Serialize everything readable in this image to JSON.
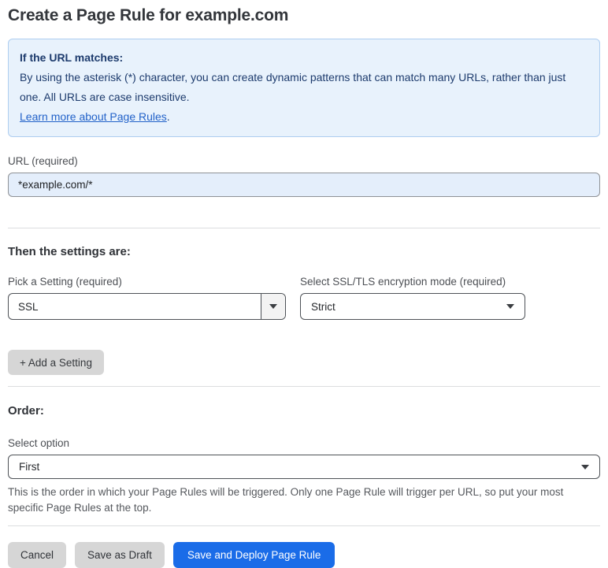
{
  "page": {
    "title": "Create a Page Rule for example.com"
  },
  "info_box": {
    "heading": "If the URL matches:",
    "body": "By using the asterisk (*) character, you can create dynamic patterns that can match many URLs, rather than just one. All URLs are case insensitive.",
    "link_label": "Learn more about Page Rules",
    "link_suffix": "."
  },
  "url_field": {
    "label": "URL (required)",
    "value": "*example.com/*"
  },
  "settings_section": {
    "heading": "Then the settings are:",
    "setting_picker": {
      "label": "Pick a Setting (required)",
      "value": "SSL"
    },
    "ssl_mode_picker": {
      "label": "Select SSL/TLS encryption mode (required)",
      "value": "Strict"
    },
    "add_setting_label": "+ Add a Setting"
  },
  "order_section": {
    "heading": "Order:",
    "select_label": "Select option",
    "value": "First",
    "help_text": "This is the order in which your Page Rules will be triggered. Only one Page Rule will trigger per URL, so put your most specific Page Rules at the top."
  },
  "footer": {
    "cancel_label": "Cancel",
    "save_draft_label": "Save as Draft",
    "save_deploy_label": "Save and Deploy Page Rule"
  },
  "icons": {
    "dropdown_arrow": "triangle-down"
  },
  "colors": {
    "primary_button": "#1a6ce8",
    "gray_button": "#d6d6d6",
    "info_background": "#e8f2fc",
    "info_border": "#aecdf0",
    "info_text": "#1d3b6d",
    "link": "#2262c9",
    "input_background": "#e4eefb",
    "divider": "#dcdddf"
  }
}
